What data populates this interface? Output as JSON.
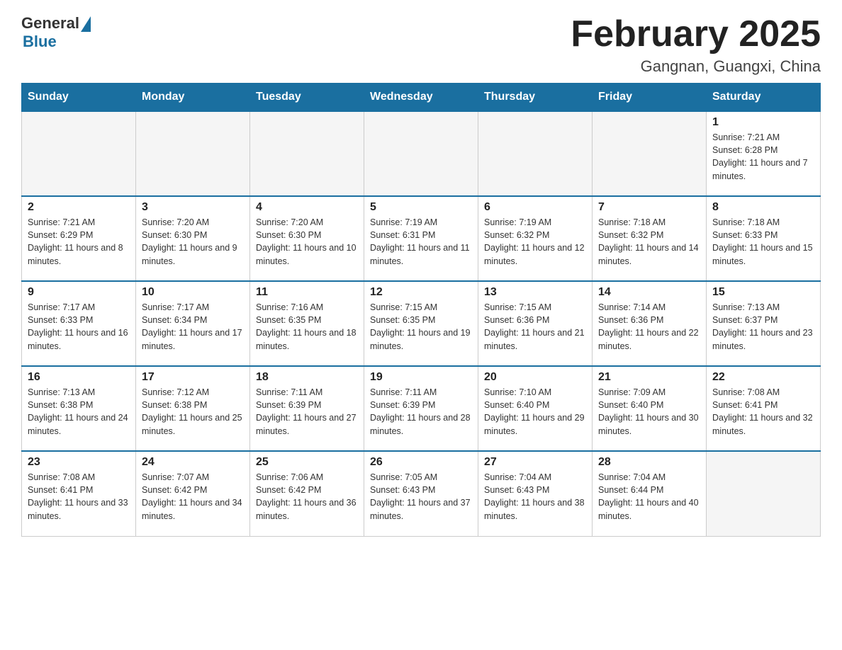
{
  "header": {
    "logo_general": "General",
    "logo_blue": "Blue",
    "month_title": "February 2025",
    "location": "Gangnan, Guangxi, China"
  },
  "weekdays": [
    "Sunday",
    "Monday",
    "Tuesday",
    "Wednesday",
    "Thursday",
    "Friday",
    "Saturday"
  ],
  "weeks": [
    [
      {
        "day": "",
        "info": ""
      },
      {
        "day": "",
        "info": ""
      },
      {
        "day": "",
        "info": ""
      },
      {
        "day": "",
        "info": ""
      },
      {
        "day": "",
        "info": ""
      },
      {
        "day": "",
        "info": ""
      },
      {
        "day": "1",
        "info": "Sunrise: 7:21 AM\nSunset: 6:28 PM\nDaylight: 11 hours and 7 minutes."
      }
    ],
    [
      {
        "day": "2",
        "info": "Sunrise: 7:21 AM\nSunset: 6:29 PM\nDaylight: 11 hours and 8 minutes."
      },
      {
        "day": "3",
        "info": "Sunrise: 7:20 AM\nSunset: 6:30 PM\nDaylight: 11 hours and 9 minutes."
      },
      {
        "day": "4",
        "info": "Sunrise: 7:20 AM\nSunset: 6:30 PM\nDaylight: 11 hours and 10 minutes."
      },
      {
        "day": "5",
        "info": "Sunrise: 7:19 AM\nSunset: 6:31 PM\nDaylight: 11 hours and 11 minutes."
      },
      {
        "day": "6",
        "info": "Sunrise: 7:19 AM\nSunset: 6:32 PM\nDaylight: 11 hours and 12 minutes."
      },
      {
        "day": "7",
        "info": "Sunrise: 7:18 AM\nSunset: 6:32 PM\nDaylight: 11 hours and 14 minutes."
      },
      {
        "day": "8",
        "info": "Sunrise: 7:18 AM\nSunset: 6:33 PM\nDaylight: 11 hours and 15 minutes."
      }
    ],
    [
      {
        "day": "9",
        "info": "Sunrise: 7:17 AM\nSunset: 6:33 PM\nDaylight: 11 hours and 16 minutes."
      },
      {
        "day": "10",
        "info": "Sunrise: 7:17 AM\nSunset: 6:34 PM\nDaylight: 11 hours and 17 minutes."
      },
      {
        "day": "11",
        "info": "Sunrise: 7:16 AM\nSunset: 6:35 PM\nDaylight: 11 hours and 18 minutes."
      },
      {
        "day": "12",
        "info": "Sunrise: 7:15 AM\nSunset: 6:35 PM\nDaylight: 11 hours and 19 minutes."
      },
      {
        "day": "13",
        "info": "Sunrise: 7:15 AM\nSunset: 6:36 PM\nDaylight: 11 hours and 21 minutes."
      },
      {
        "day": "14",
        "info": "Sunrise: 7:14 AM\nSunset: 6:36 PM\nDaylight: 11 hours and 22 minutes."
      },
      {
        "day": "15",
        "info": "Sunrise: 7:13 AM\nSunset: 6:37 PM\nDaylight: 11 hours and 23 minutes."
      }
    ],
    [
      {
        "day": "16",
        "info": "Sunrise: 7:13 AM\nSunset: 6:38 PM\nDaylight: 11 hours and 24 minutes."
      },
      {
        "day": "17",
        "info": "Sunrise: 7:12 AM\nSunset: 6:38 PM\nDaylight: 11 hours and 25 minutes."
      },
      {
        "day": "18",
        "info": "Sunrise: 7:11 AM\nSunset: 6:39 PM\nDaylight: 11 hours and 27 minutes."
      },
      {
        "day": "19",
        "info": "Sunrise: 7:11 AM\nSunset: 6:39 PM\nDaylight: 11 hours and 28 minutes."
      },
      {
        "day": "20",
        "info": "Sunrise: 7:10 AM\nSunset: 6:40 PM\nDaylight: 11 hours and 29 minutes."
      },
      {
        "day": "21",
        "info": "Sunrise: 7:09 AM\nSunset: 6:40 PM\nDaylight: 11 hours and 30 minutes."
      },
      {
        "day": "22",
        "info": "Sunrise: 7:08 AM\nSunset: 6:41 PM\nDaylight: 11 hours and 32 minutes."
      }
    ],
    [
      {
        "day": "23",
        "info": "Sunrise: 7:08 AM\nSunset: 6:41 PM\nDaylight: 11 hours and 33 minutes."
      },
      {
        "day": "24",
        "info": "Sunrise: 7:07 AM\nSunset: 6:42 PM\nDaylight: 11 hours and 34 minutes."
      },
      {
        "day": "25",
        "info": "Sunrise: 7:06 AM\nSunset: 6:42 PM\nDaylight: 11 hours and 36 minutes."
      },
      {
        "day": "26",
        "info": "Sunrise: 7:05 AM\nSunset: 6:43 PM\nDaylight: 11 hours and 37 minutes."
      },
      {
        "day": "27",
        "info": "Sunrise: 7:04 AM\nSunset: 6:43 PM\nDaylight: 11 hours and 38 minutes."
      },
      {
        "day": "28",
        "info": "Sunrise: 7:04 AM\nSunset: 6:44 PM\nDaylight: 11 hours and 40 minutes."
      },
      {
        "day": "",
        "info": ""
      }
    ]
  ]
}
